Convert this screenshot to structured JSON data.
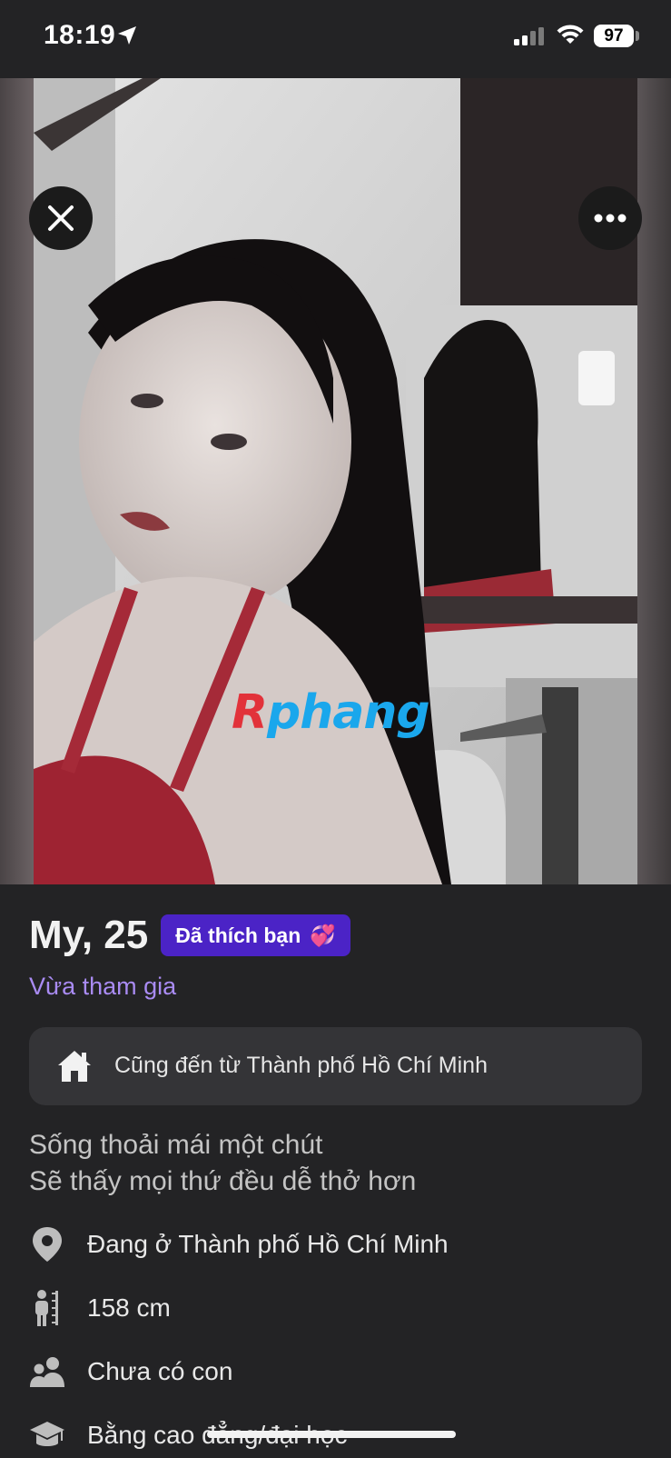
{
  "status_bar": {
    "time": "18:19",
    "battery": "97"
  },
  "photo": {
    "watermark": "Rphang"
  },
  "profile": {
    "name_age": "My, 25",
    "liked_badge": "Đã thích bạn",
    "liked_emoji": "💞",
    "joined": "Vừa tham gia",
    "hometown": "Cũng đến từ Thành phố Hồ Chí Minh",
    "bio_lines": [
      "Sống thoải mái một chút",
      "Sẽ thấy mọi thứ đều dễ thở hơn"
    ],
    "info": [
      {
        "icon": "location-pin-icon",
        "text": "Đang ở Thành phố Hồ Chí Minh"
      },
      {
        "icon": "height-icon",
        "text": "158 cm"
      },
      {
        "icon": "children-icon",
        "text": "Chưa có con"
      },
      {
        "icon": "education-icon",
        "text": "Bằng cao đẳng/đại học"
      }
    ]
  },
  "colors": {
    "background": "#232325",
    "accent_purple": "#4b23c6",
    "joined_text": "#a98bf3",
    "card": "#343437"
  }
}
